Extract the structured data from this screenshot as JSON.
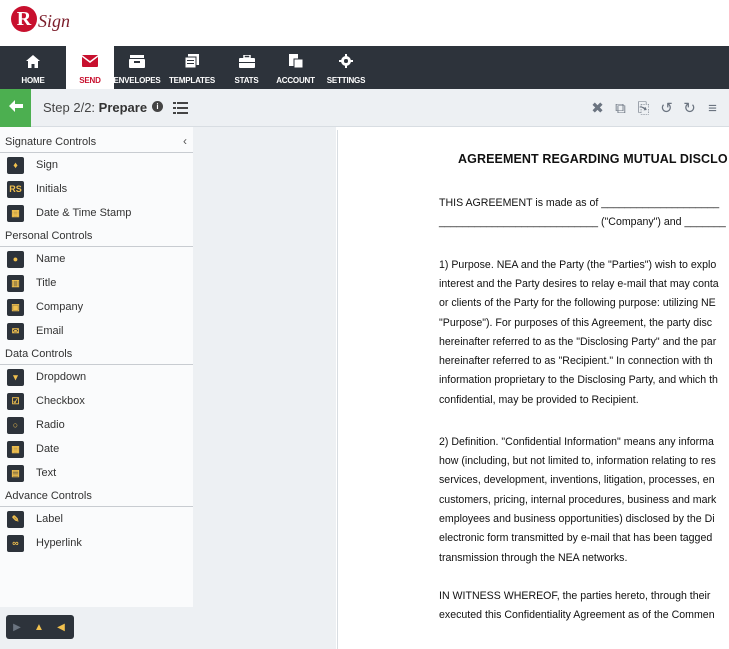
{
  "logo": {
    "initial": "R",
    "text": "Sign"
  },
  "nav": [
    {
      "label": "HOME",
      "icon": "home-icon"
    },
    {
      "label": "SEND",
      "icon": "envelope-icon"
    },
    {
      "label": "ENVELOPES",
      "icon": "inbox-icon"
    },
    {
      "label": "TEMPLATES",
      "icon": "templates-icon"
    },
    {
      "label": "STATS",
      "icon": "briefcase-icon"
    },
    {
      "label": "ACCOUNT",
      "icon": "account-icon"
    },
    {
      "label": "SETTINGS",
      "icon": "gear-icon"
    }
  ],
  "step": {
    "prefix": "Step 2/2: ",
    "title": "Prepare"
  },
  "sidebar": {
    "signature_controls": {
      "heading": "Signature Controls",
      "items": [
        "Sign",
        "Initials",
        "Date & Time Stamp"
      ]
    },
    "personal_controls": {
      "heading": "Personal Controls",
      "items": [
        "Name",
        "Title",
        "Company",
        "Email"
      ]
    },
    "data_controls": {
      "heading": "Data Controls",
      "items": [
        "Dropdown",
        "Checkbox",
        "Radio",
        "Date",
        "Text"
      ]
    },
    "advance_controls": {
      "heading": "Advance Controls",
      "items": [
        "Label",
        "Hyperlink"
      ]
    },
    "initials_badge": "RS"
  },
  "document": {
    "title": "AGREEMENT REGARDING MUTUAL DISCLO",
    "lines": [
      "THIS AGREEMENT is made as of ____________________",
      "___________________________ (\"Company\") and _______",
      "1) Purpose.  NEA and the Party (the \"Parties\") wish to explo",
      "interest and the Party desires to relay e-mail that may conta",
      "or clients of the Party for the following purpose: utilizing NE",
      "\"Purpose\").  For purposes of this Agreement, the party disc",
      "hereinafter referred to as the \"Disclosing Party\" and the par",
      "hereinafter referred to as \"Recipient.\"  In connection with th",
      "information proprietary to the Disclosing Party, and which th",
      "confidential, may be provided to Recipient.",
      "2) Definition.  \"Confidential Information\" means any informa",
      "how (including, but not limited to, information relating to res",
      "services, development, inventions, litigation, processes, en",
      "customers, pricing, internal procedures, business and mark",
      "employees and business opportunities) disclosed by the Di",
      "electronic form transmitted by e-mail that has been tagged",
      "transmission through the NEA networks.",
      "IN WITNESS WHEREOF, the parties hereto, through their",
      "executed this Confidentiality Agreement as of the Commen"
    ]
  },
  "colors": {
    "brand": "#c8102e",
    "nav_bg": "#2d333b",
    "accent_icon": "#f2c14e",
    "back_button": "#4caf50"
  }
}
